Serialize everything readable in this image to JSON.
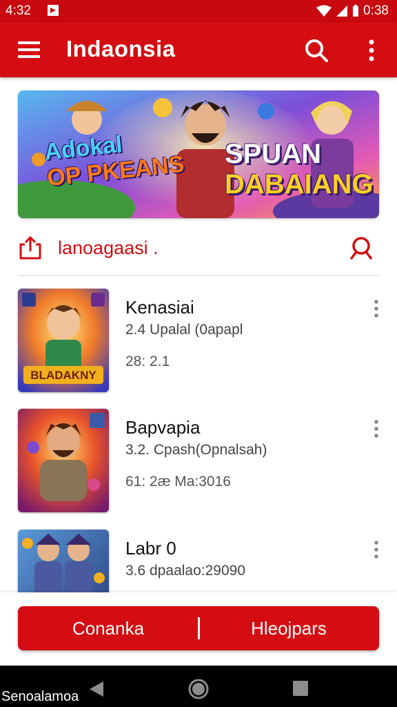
{
  "status_bar": {
    "time": "4:32",
    "battery_text": "0:38"
  },
  "app_bar": {
    "title": "Indaonsia"
  },
  "banner": {
    "left_line1": "Adokal",
    "left_line2": "OP PKEANS",
    "right_line1": "SPUAN",
    "right_line2": "DABAIANG"
  },
  "section": {
    "title": "lanoagaasi ."
  },
  "games": [
    {
      "name": "Kenasiai",
      "meta": "2.4  Upalal (0apapl",
      "extra": "28: 2.1",
      "thumb_text": "BLADAKNY"
    },
    {
      "name": "Bapvapia",
      "meta": "3.2. Cpash(Opnalsah)",
      "extra": "61: 2æ Ma:3016",
      "thumb_text": ""
    },
    {
      "name": "Labr 0",
      "meta": "3.6  dpaalao:29090",
      "extra": "",
      "thumb_text": ""
    }
  ],
  "actions": {
    "left_label": "Conanka",
    "right_label": "Hleojpars"
  },
  "nav": {
    "label": "Senoalamoa"
  },
  "colors": {
    "primary": "#d40d12",
    "status": "#c8090f"
  }
}
